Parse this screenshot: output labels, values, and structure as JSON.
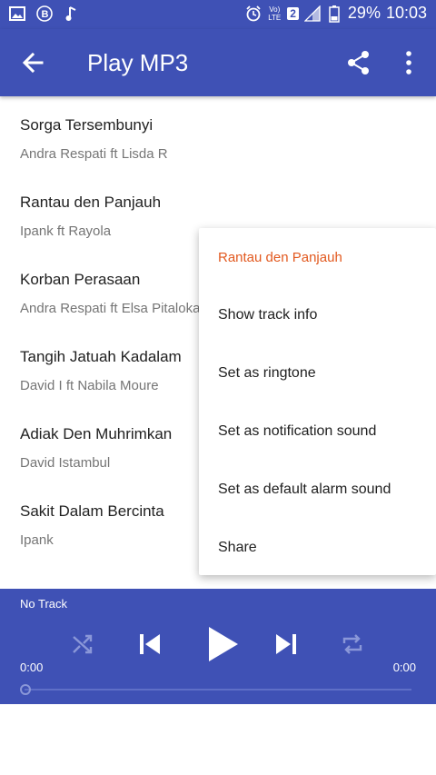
{
  "status": {
    "lte_label": "Vo) LTE",
    "sim_label": "2",
    "battery": "29%",
    "time": "10:03"
  },
  "toolbar": {
    "title": "Play MP3"
  },
  "tracks": [
    {
      "title": "Sorga Tersembunyi",
      "artist": "Andra Respati ft Lisda R"
    },
    {
      "title": "Rantau den Panjauh",
      "artist": "Ipank ft Rayola"
    },
    {
      "title": "Korban Perasaan",
      "artist": "Andra Respati ft Elsa Pitaloka"
    },
    {
      "title": "Tangih Jatuah Kadalam",
      "artist": "David I ft Nabila Moure"
    },
    {
      "title": "Adiak Den Muhrimkan",
      "artist": "David Istambul"
    },
    {
      "title": "Sakit Dalam Bercinta",
      "artist": "Ipank"
    }
  ],
  "menu": {
    "header": "Rantau den Panjauh",
    "items": [
      "Show track info",
      "Set as ringtone",
      "Set as notification sound",
      "Set as default alarm sound",
      "Share"
    ]
  },
  "player": {
    "track_label": "No Track",
    "time_elapsed": "0:00",
    "time_total": "0:00",
    "progress": 0
  },
  "colors": {
    "primary": "#3f51b5",
    "accent": "#e2591f"
  },
  "icons": [
    "image-icon",
    "b-icon",
    "music-note-icon",
    "alarm-icon",
    "signal-icon",
    "battery-icon",
    "back-arrow-icon",
    "share-icon",
    "more-vert-icon",
    "shuffle-icon",
    "skip-previous-icon",
    "play-icon",
    "skip-next-icon",
    "repeat-icon"
  ]
}
